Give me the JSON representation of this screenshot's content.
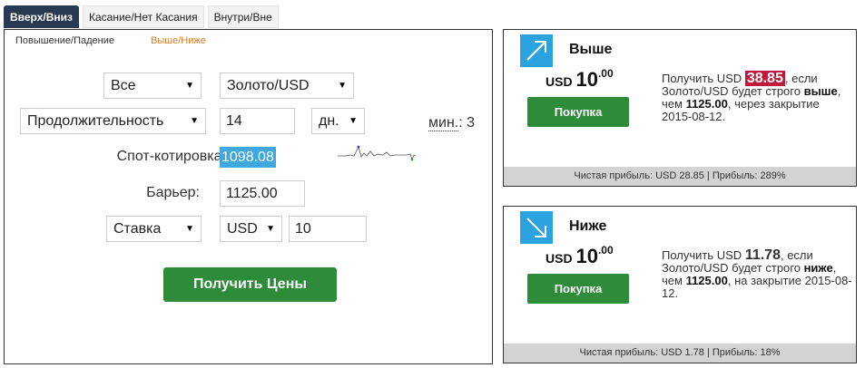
{
  "tabs": [
    {
      "label": "Вверх/Вниз",
      "active": true
    },
    {
      "label": "Касание/Нет Касания",
      "active": false
    },
    {
      "label": "Внутри/Вне",
      "active": false
    }
  ],
  "subtabs": [
    {
      "label": "Повышение/Падение",
      "active": false
    },
    {
      "label": "Выше/Ниже",
      "active": true
    }
  ],
  "form": {
    "market_select": "Все",
    "asset_select": "Золото/USD",
    "duration_type_select": "Продолжительность",
    "duration_value": "14",
    "duration_unit_select": "дн.",
    "min_label": "мин.",
    "min_value": "3",
    "spot_label": "Спот-котировка:",
    "spot_value": "1098.08",
    "barrier_label": "Барьер:",
    "barrier_value": "1125.00",
    "amount_type_select": "Ставка",
    "currency_select": "USD",
    "amount_value": "10",
    "get_prices_button": "Получить Цены"
  },
  "cards": [
    {
      "title": "Выше",
      "icon": "arrow-up-right-icon",
      "currency": "USD",
      "price_main": "10",
      "price_cents": ".00",
      "buy_label": "Покупка",
      "desc_pre": "Получить USD ",
      "payout": "38.85",
      "desc_mid1": ", если Золото/USD будет строго ",
      "direction": "выше",
      "desc_mid2": ", чем ",
      "barrier": "1125.00",
      "desc_end": ", через закрытие 2015-08-12.",
      "footer": "Чистая прибыль: USD 28.85 | Прибыль: 289%"
    },
    {
      "title": "Ниже",
      "icon": "arrow-down-right-icon",
      "currency": "USD",
      "price_main": "10",
      "price_cents": ".00",
      "buy_label": "Покупка",
      "desc_pre": "Получить USD ",
      "payout": "11.78",
      "desc_mid1": ", если Золото/USD будет строго ",
      "direction": "ниже",
      "desc_mid2": ", чем ",
      "barrier": "1125.00",
      "desc_end": ", на закрытие 2015-08-12.",
      "footer": "Чистая прибыль: USD 1.78 | Прибыль: 18%"
    }
  ],
  "colors": {
    "accent_blue": "#2aa3e0",
    "button_green": "#2e8b3a",
    "highlight_red": "#c2183c",
    "active_tab": "#2a3a52",
    "active_subtab": "#e07b1d"
  }
}
